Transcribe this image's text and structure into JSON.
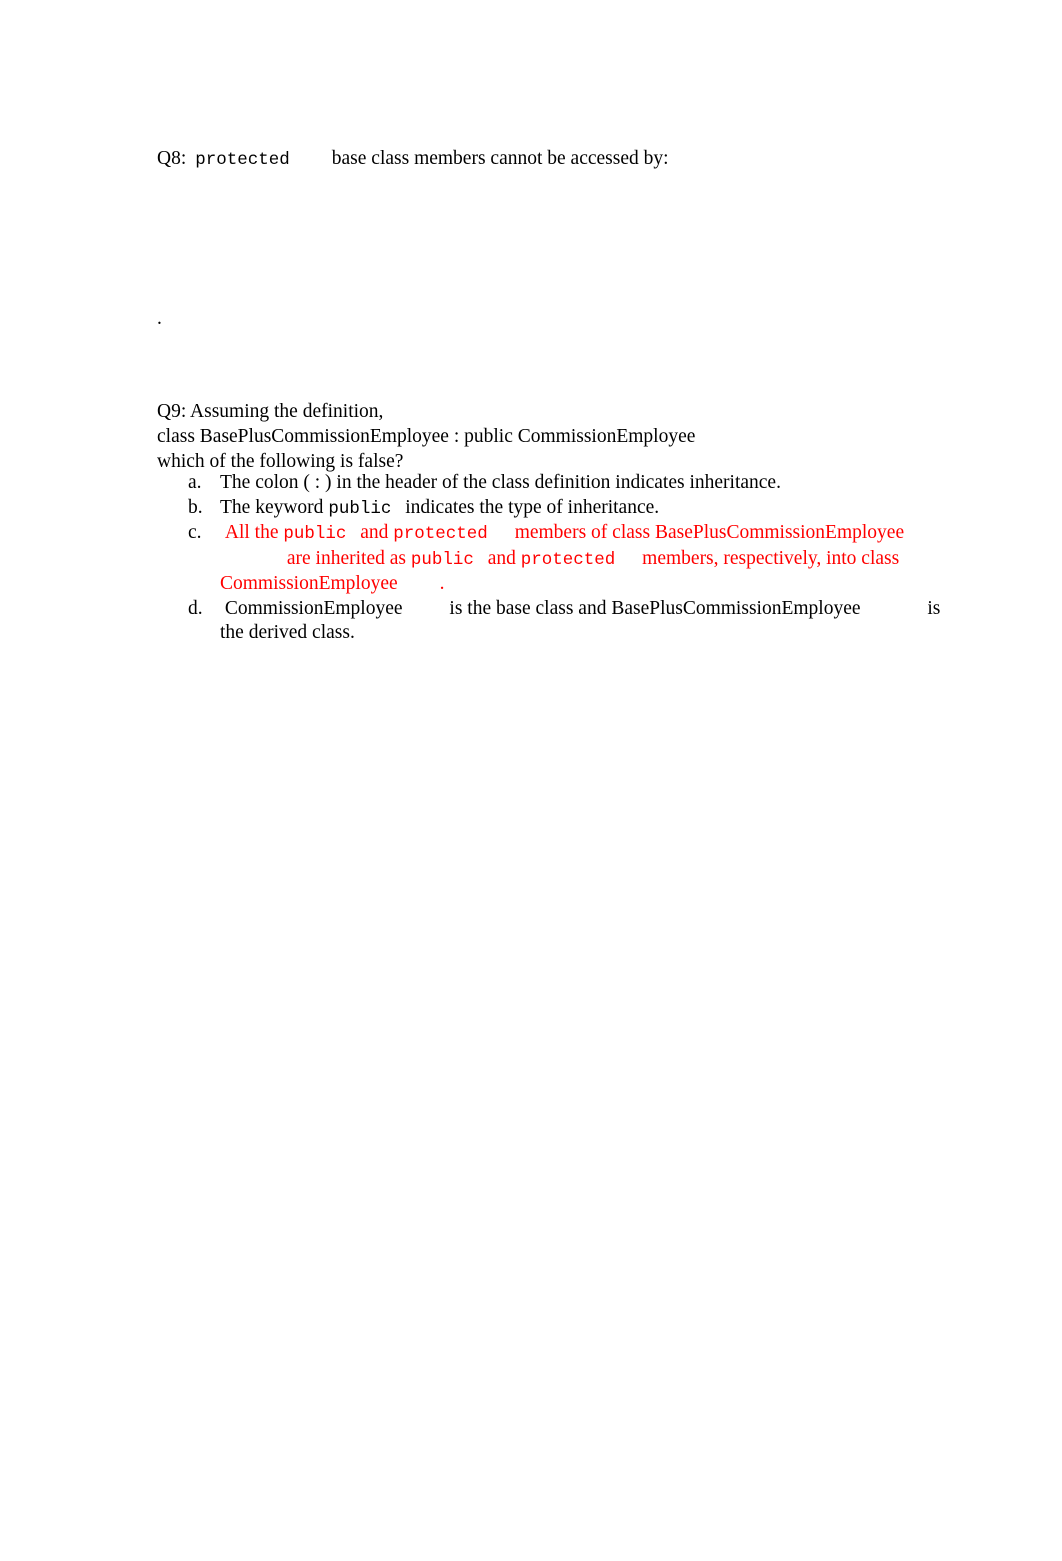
{
  "document": {
    "page_background": "#ffffff",
    "text_color": "#000000",
    "highlight_color": "#ff0000"
  },
  "q8": {
    "label": "Q8:",
    "keyword": "protected",
    "rest": "base class members cannot be accessed by:"
  },
  "stray": {
    "period": "."
  },
  "q9": {
    "line1": "Q9: Assuming the definition,",
    "line2": "class BasePlusCommissionEmployee : public CommissionEmployee",
    "line3": "which of the following is false?",
    "options": [
      {
        "marker": "a.",
        "color": "#000000",
        "parts": [
          {
            "type": "text",
            "value": "The colon ( : ) in the header of the class definition indicates inheritance."
          }
        ],
        "plain": "The colon ( : ) in the header of the class definition indicates inheritance."
      },
      {
        "marker": "b.",
        "color": "#000000",
        "parts": [
          {
            "type": "text",
            "value": "The keyword "
          },
          {
            "type": "mono",
            "value": "public"
          },
          {
            "type": "gap",
            "value": "sm"
          },
          {
            "type": "text",
            "value": " indicates the type of inheritance."
          }
        ],
        "plain": "The keyword public indicates the type of inheritance."
      },
      {
        "marker": "c.",
        "color": "#ff0000",
        "parts": [
          {
            "type": "text",
            "value": " All the "
          },
          {
            "type": "mono",
            "value": "public"
          },
          {
            "type": "gap",
            "value": "sm"
          },
          {
            "type": "text",
            "value": " and "
          },
          {
            "type": "mono",
            "value": "protected"
          },
          {
            "type": "gap",
            "value": "md"
          },
          {
            "type": "text",
            "value": " members of class BasePlusCommissionEmployee"
          },
          {
            "type": "gap",
            "value": "xl"
          },
          {
            "type": "text",
            "value": " are inherited as "
          },
          {
            "type": "mono",
            "value": "public"
          },
          {
            "type": "gap",
            "value": "sm"
          },
          {
            "type": "text",
            "value": " and "
          },
          {
            "type": "mono",
            "value": "protected"
          },
          {
            "type": "gap",
            "value": "md"
          },
          {
            "type": "text",
            "value": " members, respectively, into class CommissionEmployee"
          },
          {
            "type": "gap",
            "value": "lg"
          },
          {
            "type": "text",
            "value": "."
          }
        ],
        "plain": "All the public and protected members of class BasePlusCommissionEmployee are inherited as public and protected members, respectively, into class CommissionEmployee ."
      },
      {
        "marker": "d.",
        "color": "#000000",
        "parts": [
          {
            "type": "text",
            "value": " CommissionEmployee"
          },
          {
            "type": "gap",
            "value": "lg"
          },
          {
            "type": "text",
            "value": " is the base class and BasePlusCommissionEmployee"
          },
          {
            "type": "gap",
            "value": "xl"
          },
          {
            "type": "text",
            "value": " is the derived class."
          }
        ],
        "plain": "CommissionEmployee is the base class and BasePlusCommissionEmployee is the derived class."
      }
    ]
  }
}
